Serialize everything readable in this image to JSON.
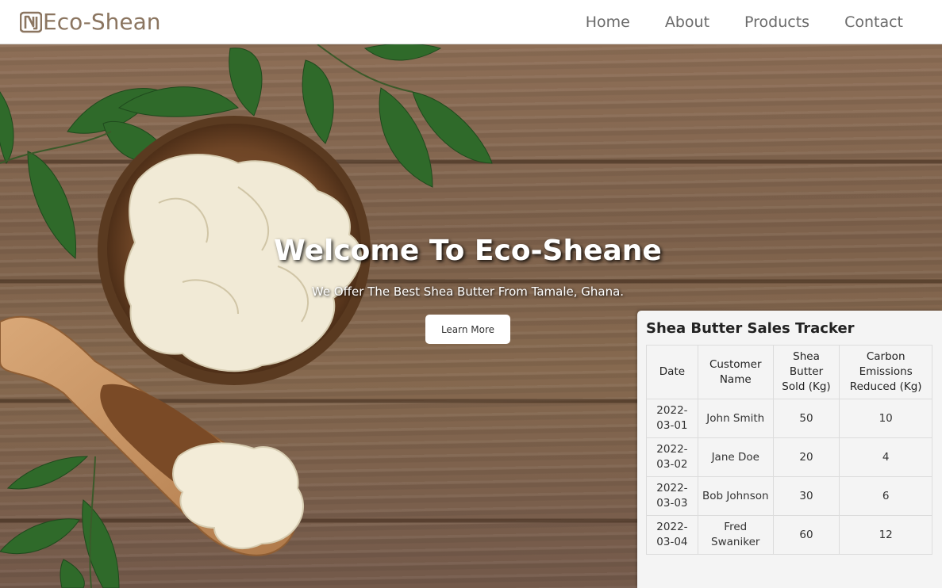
{
  "header": {
    "brand": "Eco-Shean",
    "nav": [
      "Home",
      "About",
      "Products",
      "Contact"
    ]
  },
  "hero": {
    "title": "Welcome To Eco-Sheane",
    "subtitle": "We Offer The Best Shea Butter From Tamale, Ghana.",
    "button": "Learn More"
  },
  "tracker": {
    "title": "Shea Butter Sales Tracker",
    "columns": [
      "Date",
      "Customer Name",
      "Shea Butter Sold (Kg)",
      "Carbon Emissions Reduced (Kg)"
    ],
    "rows": [
      {
        "date": "2022-03-01",
        "customer": "John Smith",
        "sold": "50",
        "carbon": "10"
      },
      {
        "date": "2022-03-02",
        "customer": "Jane Doe",
        "sold": "20",
        "carbon": "4"
      },
      {
        "date": "2022-03-03",
        "customer": "Bob Johnson",
        "sold": "30",
        "carbon": "6"
      },
      {
        "date": "2022-03-04",
        "customer": "Fred Swaniker",
        "sold": "60",
        "carbon": "12"
      }
    ]
  },
  "colors": {
    "brand": "#8b7560",
    "nav": "#6b6b6b",
    "wood": "#806450",
    "leaf": "#2f6a2a"
  }
}
